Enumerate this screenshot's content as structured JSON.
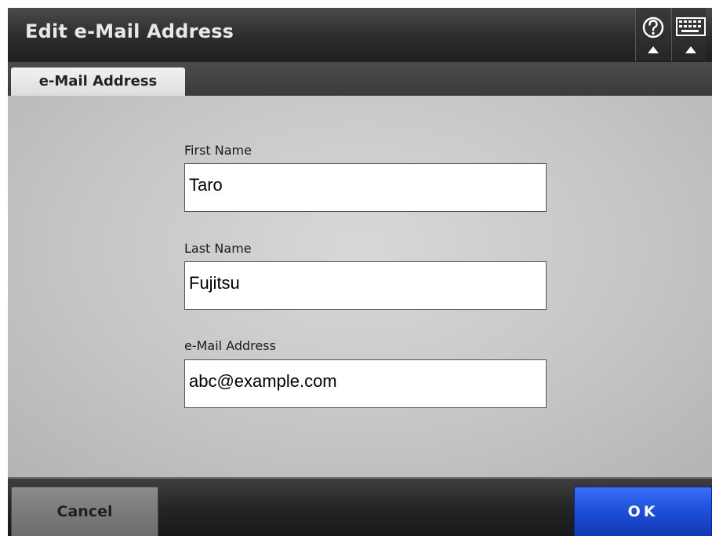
{
  "window": {
    "title": "Edit e-Mail Address"
  },
  "toolbar": {
    "help_icon": "help-question-icon",
    "keyboard_icon": "keyboard-icon"
  },
  "tabs": [
    {
      "label": "e-Mail Address",
      "active": true
    }
  ],
  "form": {
    "first_name": {
      "label": "First Name",
      "value": "Taro"
    },
    "last_name": {
      "label": "Last Name",
      "value": "Fujitsu"
    },
    "email": {
      "label": "e-Mail Address",
      "value": "abc@example.com"
    }
  },
  "footer": {
    "cancel_label": "Cancel",
    "ok_label": "OK"
  },
  "colors": {
    "ok_button": "#1c4ed8",
    "title_bar": "#2c2c2c"
  }
}
